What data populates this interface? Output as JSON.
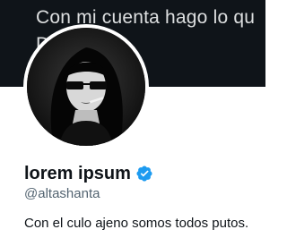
{
  "banner": {
    "line1": "Con mi cuenta hago lo qu",
    "line2": "D          O"
  },
  "profile": {
    "display_name": "lorem ipsum",
    "handle": "@altashanta",
    "bio": "Con el culo ajeno somos todos putos."
  },
  "icons": {
    "verified": "verified-badge-icon"
  },
  "colors": {
    "banner_bg": "#0f1419",
    "verified_blue": "#1d9bf0",
    "handle_gray": "#536471",
    "text_dark": "#0f1419"
  }
}
